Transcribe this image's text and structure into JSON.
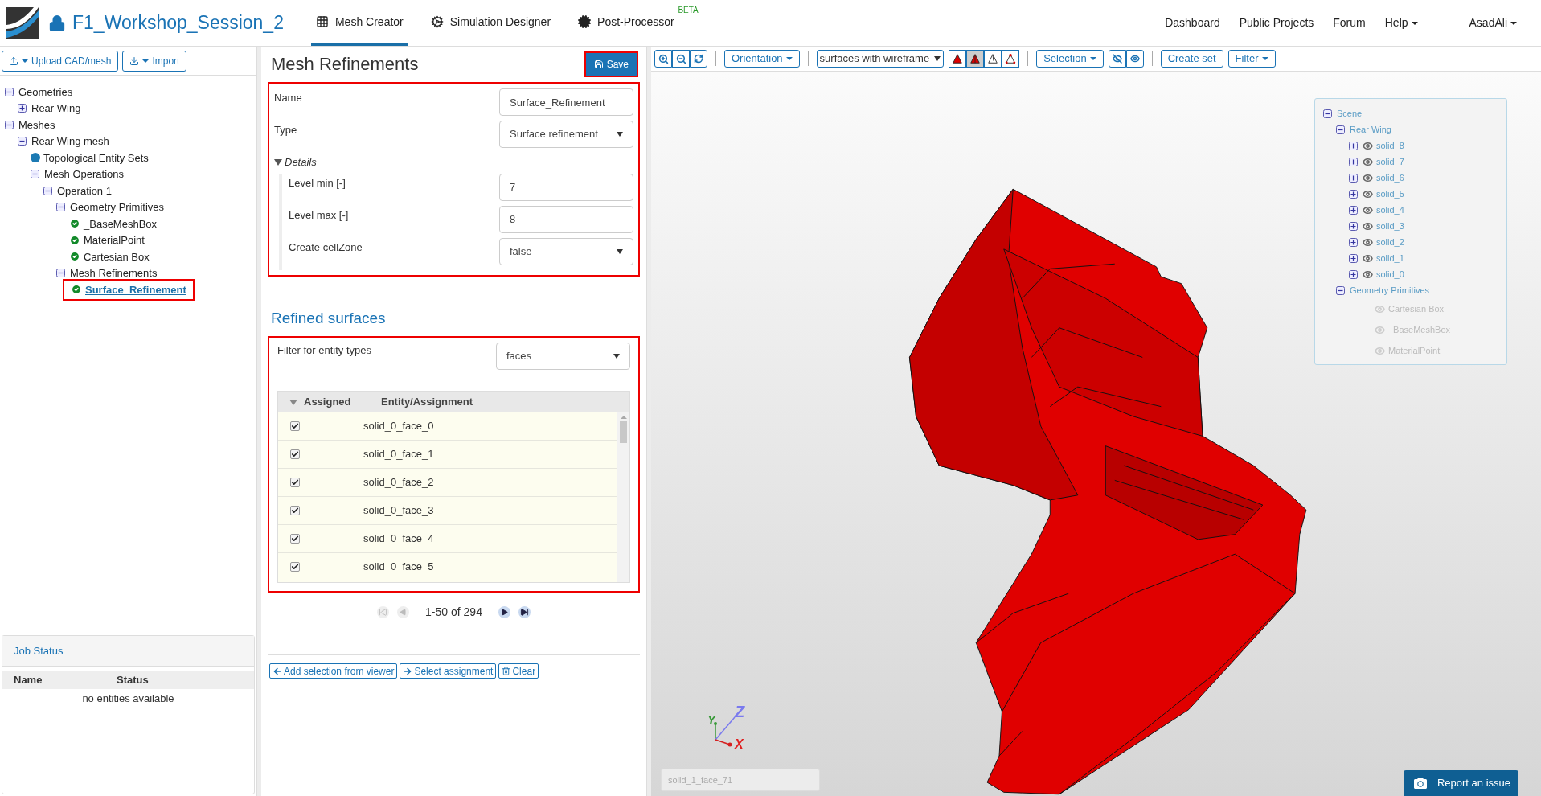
{
  "header": {
    "title": "F1_Workshop_Session_2",
    "nav": [
      {
        "label": "Mesh Creator",
        "selected": true
      },
      {
        "label": "Simulation Designer",
        "selected": false
      },
      {
        "label": "Post-Processor",
        "selected": false,
        "badge": "BETA"
      }
    ],
    "menu": [
      {
        "label": "Dashboard",
        "dropdown": false
      },
      {
        "label": "Public Projects",
        "dropdown": false
      },
      {
        "label": "Forum",
        "dropdown": false
      },
      {
        "label": "Help",
        "dropdown": true
      },
      {
        "label": "AsadAli",
        "dropdown": true
      }
    ]
  },
  "left_toolbar": [
    {
      "label": "Upload CAD/mesh"
    },
    {
      "label": "Import"
    }
  ],
  "tree": [
    {
      "label": "Geometries",
      "kind": "group",
      "expanded": true,
      "selected": false,
      "children": [
        {
          "label": "Rear Wing",
          "kind": "group",
          "expanded": false,
          "selected": false
        }
      ]
    },
    {
      "label": "Meshes",
      "kind": "group",
      "expanded": true,
      "selected": false,
      "children": [
        {
          "label": "Rear Wing mesh",
          "kind": "group",
          "expanded": true,
          "selected": false,
          "children": [
            {
              "label": "Topological Entity Sets",
              "kind": "set",
              "selected": false
            },
            {
              "label": "Mesh Operations",
              "kind": "group",
              "expanded": true,
              "selected": false,
              "children": [
                {
                  "label": "Operation 1",
                  "kind": "group",
                  "expanded": true,
                  "selected": false,
                  "children": [
                    {
                      "label": "Geometry Primitives",
                      "kind": "group",
                      "expanded": true,
                      "selected": false,
                      "children": [
                        {
                          "label": "_BaseMeshBox",
                          "kind": "item",
                          "selected": false
                        },
                        {
                          "label": "MaterialPoint",
                          "kind": "item",
                          "selected": false
                        },
                        {
                          "label": "Cartesian Box",
                          "kind": "item",
                          "selected": false
                        }
                      ]
                    },
                    {
                      "label": "Mesh Refinements",
                      "kind": "group",
                      "expanded": true,
                      "selected": false,
                      "children": [
                        {
                          "label": "Surface_Refinement",
                          "kind": "item",
                          "selected": true
                        }
                      ]
                    }
                  ]
                }
              ]
            }
          ]
        }
      ]
    }
  ],
  "job_status": {
    "title": "Job Status",
    "columns": [
      "Name",
      "Status"
    ],
    "empty": "no entities available"
  },
  "editor": {
    "title": "Mesh Refinements",
    "save": "Save",
    "fields": [
      {
        "label": "Name",
        "kind": "text",
        "value": "Surface_Refinement"
      },
      {
        "label": "Type",
        "kind": "select",
        "value": "Surface refinement"
      }
    ],
    "details": {
      "label": "Details",
      "expanded": true,
      "fields": [
        {
          "label": "Level min [-]",
          "kind": "text",
          "value": "7"
        },
        {
          "label": "Level max [-]",
          "kind": "text",
          "value": "8"
        },
        {
          "label": "Create cellZone",
          "kind": "select",
          "value": "false"
        }
      ]
    }
  },
  "refined": {
    "title": "Refined surfaces",
    "filter": {
      "label": "Filter for entity types",
      "value": "faces"
    },
    "columns": [
      "Assigned",
      "Entity/Assignment"
    ],
    "rows": [
      {
        "entity": "solid_0_face_0",
        "checked": true
      },
      {
        "entity": "solid_0_face_1",
        "checked": true
      },
      {
        "entity": "solid_0_face_2",
        "checked": true
      },
      {
        "entity": "solid_0_face_3",
        "checked": true
      },
      {
        "entity": "solid_0_face_4",
        "checked": true
      },
      {
        "entity": "solid_0_face_5",
        "checked": true
      }
    ],
    "pagination": "1-50 of 294",
    "actions": [
      {
        "label": "Add selection from viewer"
      },
      {
        "label": "Select assignment"
      },
      {
        "label": "Clear"
      }
    ]
  },
  "viewer": {
    "orientation": "Orientation",
    "display": "surfaces with wireframe",
    "render_modes": [
      {
        "selected": false
      },
      {
        "selected": true
      },
      {
        "selected": false
      },
      {
        "selected": false
      }
    ],
    "selection": "Selection",
    "create_set": "Create set",
    "filter": "Filter",
    "scene": [
      {
        "label": "Scene",
        "expanded": true,
        "children": [
          {
            "label": "Rear Wing",
            "expanded": true,
            "children": [
              {
                "label": "solid_8",
                "expanded": false,
                "visible": true
              },
              {
                "label": "solid_7",
                "expanded": false,
                "visible": true
              },
              {
                "label": "solid_6",
                "expanded": false,
                "visible": true
              },
              {
                "label": "solid_5",
                "expanded": false,
                "visible": true
              },
              {
                "label": "solid_4",
                "expanded": false,
                "visible": true
              },
              {
                "label": "solid_3",
                "expanded": false,
                "visible": true
              },
              {
                "label": "solid_2",
                "expanded": false,
                "visible": true
              },
              {
                "label": "solid_1",
                "expanded": false,
                "visible": true
              },
              {
                "label": "solid_0",
                "expanded": false,
                "visible": true
              }
            ]
          },
          {
            "label": "Geometry Primitives",
            "expanded": true,
            "children": [
              {
                "label": "Cartesian Box",
                "visible": false
              },
              {
                "label": "_BaseMeshBox",
                "visible": false
              },
              {
                "label": "MaterialPoint",
                "visible": false
              }
            ]
          }
        ]
      }
    ],
    "axes": {
      "x": "X",
      "y": "Y",
      "z": "Z"
    },
    "selection_field": {
      "placeholder": "solid_1_face_71"
    },
    "report": "Report an issue"
  }
}
